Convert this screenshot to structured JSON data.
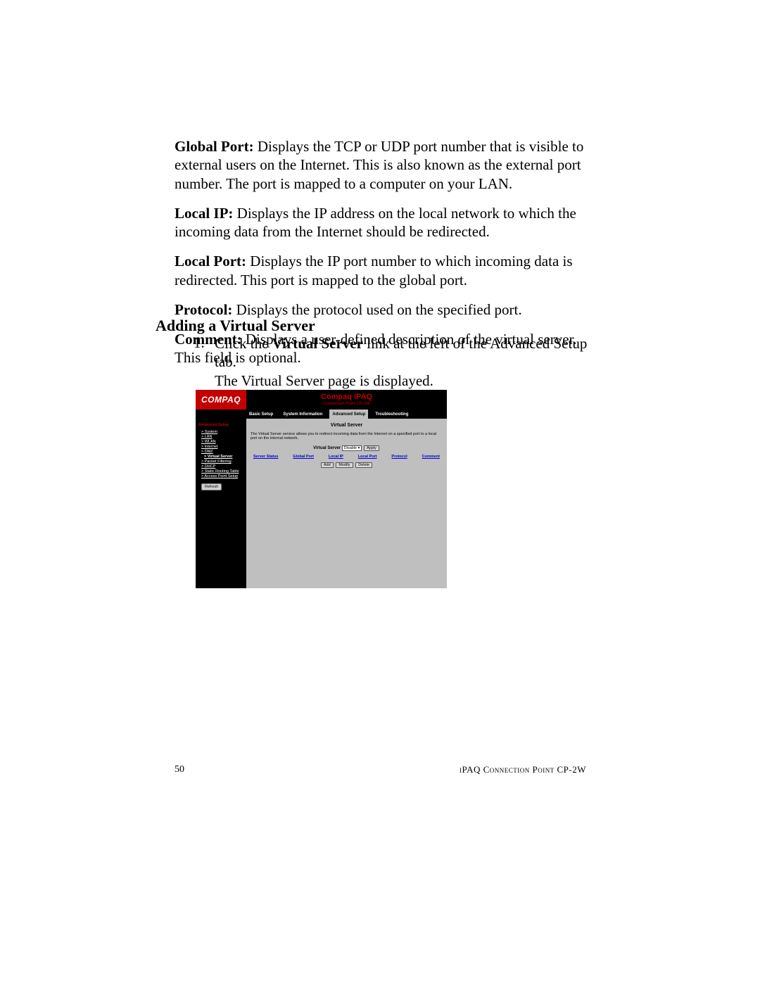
{
  "definitions": [
    {
      "term": "Global Port:",
      "text": " Displays the TCP or UDP port number that is visible to external users on the Internet. This is also known as the external port number. The port is mapped to a computer on your LAN."
    },
    {
      "term": "Local IP:",
      "text": " Displays the IP address on the local network to which the incoming data from the Internet should be redirected."
    },
    {
      "term": "Local Port:",
      "text": " Displays the IP port number to which incoming data is redirected. This port is mapped to the global port."
    },
    {
      "term": "Protocol:",
      "text": " Displays the protocol used on the specified port."
    },
    {
      "term": "Comment:",
      "text": " Displays a user-defined description of the virtual server. This field is optional."
    }
  ],
  "heading": "Adding a Virtual Server",
  "step": {
    "num": "1.",
    "line1a": "Click the ",
    "line1b": "Virtual Server",
    "line1c": " link at the left of the Advanced Setup tab.",
    "line2": "The Virtual Server page is displayed."
  },
  "ui": {
    "logo": "COMPAQ",
    "title": "Compaq iPAQ",
    "subtitle": "Connection Point CP-2W",
    "tabs": [
      "Basic Setup",
      "System Information",
      "Advanced Setup",
      "Troubleshooting"
    ],
    "active_tab_index": 2,
    "sidebar": {
      "heading": "Advanced Setup",
      "items": [
        {
          "label": "> System",
          "sub": false
        },
        {
          "label": "> LAN",
          "sub": false
        },
        {
          "label": "> WLAN",
          "sub": false
        },
        {
          "label": "> Internet",
          "sub": false
        },
        {
          "label": "> DMZ",
          "sub": false
        },
        {
          "label": "> Virtual Server",
          "sub": true,
          "selected": true
        },
        {
          "label": "> Packet Filtering",
          "sub": false
        },
        {
          "label": "> DHCP",
          "sub": false
        },
        {
          "label": "> Static Routing Table",
          "sub": false
        },
        {
          "label": "> Access Point Setup",
          "sub": false
        }
      ],
      "refresh": "Refresh"
    },
    "main": {
      "page_title": "Virtual Server",
      "desc": "The Virtual Server service allows you to redirect incoming data from the Internet on a specified port to a local port on the internal network.",
      "control_label": "Virtual Server",
      "select_value": "Disable",
      "apply": "Apply",
      "columns": [
        "Server Status",
        "Global Port",
        "Local IP",
        "Local Port",
        "Protocol",
        "Comment"
      ],
      "buttons": [
        "Add",
        "Modify",
        "Delete"
      ]
    }
  },
  "footer": {
    "page": "50",
    "doc": "iPAQ Connection Point CP-2W"
  }
}
